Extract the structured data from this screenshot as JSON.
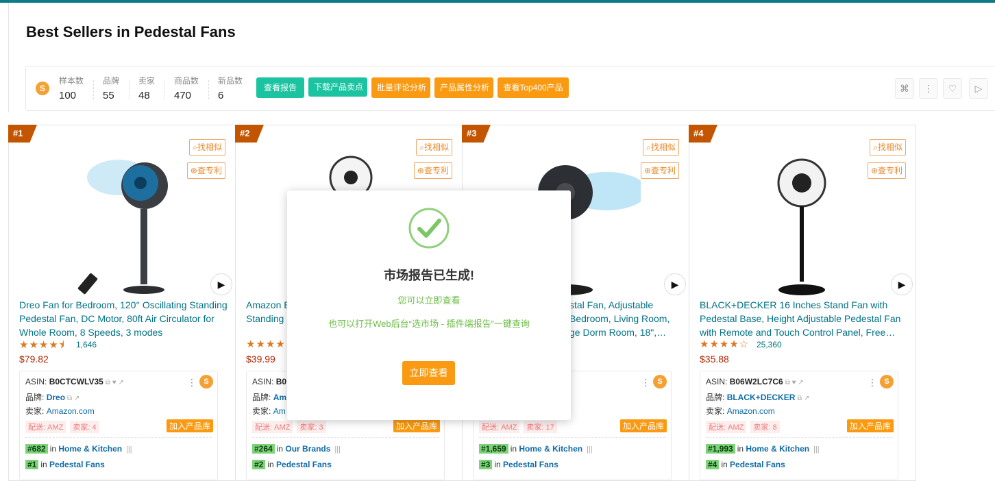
{
  "page": {
    "title": "Best Sellers in Pedestal Fans"
  },
  "stats": [
    {
      "label": "样本数",
      "value": "100"
    },
    {
      "label": "品牌",
      "value": "55"
    },
    {
      "label": "卖家",
      "value": "48"
    },
    {
      "label": "商品数",
      "value": "470"
    },
    {
      "label": "新品数",
      "value": "6"
    }
  ],
  "buttons": {
    "view_report": "查看报告",
    "download_points": "下载产品卖点",
    "bulk_review": "批量评论分析",
    "attr_analysis": "产品属性分析",
    "top400": "查看Top400产品"
  },
  "common": {
    "find_similar": "找相似",
    "check_patent": "查专利",
    "asin_label": "ASIN:",
    "brand_label": "品牌:",
    "seller_label": "卖家:",
    "delivery_label": "配送: AMZ",
    "add_library": "加入产品库",
    "in": "in"
  },
  "products": [
    {
      "rank": "#1",
      "title": "Dreo Fan for Bedroom, 120° Oscillating Standing Pedestal Fan, DC Motor, 80ft Air Circulator for Whole Room, 8 Speeds, 3 modes",
      "stars": "★★★★⯨",
      "reviews": "1,646",
      "price": "$79.82",
      "asin": "B0CTCWLV35",
      "brand": "Dreo",
      "seller": "Amazon.com",
      "sellers_count": "卖家: 4",
      "rank1": "#682",
      "cat1": "Home & Kitchen",
      "rank2": "#1",
      "cat2": "Pedestal Fans"
    },
    {
      "rank": "#2",
      "title": "Amazon Basics Oscillating Pedestal Fan, Standing Fan with Remote and Dual Blade",
      "stars": "★★★★",
      "reviews": "",
      "price": "$39.99",
      "asin": "B0",
      "brand": "Am",
      "seller": "Am",
      "sellers_count": "卖家: 3",
      "rank1": "#264",
      "cat1": "Our Brands",
      "rank2": "#2",
      "cat2": "Pedestal Fans"
    },
    {
      "rank": "#3",
      "title": "stal Fan, Adjustable Bedroom, Living Room, ge Dorm Room, 18\",…",
      "stars": "",
      "reviews": "",
      "price": "",
      "asin": "",
      "brand": "",
      "seller": "",
      "sellers_count": "卖家: 17",
      "rank1": "#1,659",
      "cat1": "Home & Kitchen",
      "rank2": "#3",
      "cat2": "Pedestal Fans"
    },
    {
      "rank": "#4",
      "title": "BLACK+DECKER 16 Inches Stand Fan with Pedestal Base, Height Adjustable Pedestal Fan with Remote and Touch Control Panel, Free…",
      "stars": "★★★★☆",
      "reviews": "25,360",
      "price": "$35.88",
      "asin": "B06W2LC7C6",
      "brand": "BLACK+DECKER",
      "seller": "Amazon.com",
      "sellers_count": "卖家: 8",
      "rank1": "#1,993",
      "cat1": "Home & Kitchen",
      "rank2": "#4",
      "cat2": "Pedestal Fans"
    }
  ],
  "modal": {
    "title": "市场报告已生成!",
    "sub1": "您可以立即查看",
    "sub2": "也可以打开Web后台“选市场 - 插件端报告”一键查询",
    "button": "立即查看"
  },
  "colors": {
    "accent_teal": "#1bc3a1",
    "accent_orange": "#fa9a12",
    "rank_brown": "#c45500",
    "link": "#007185"
  }
}
